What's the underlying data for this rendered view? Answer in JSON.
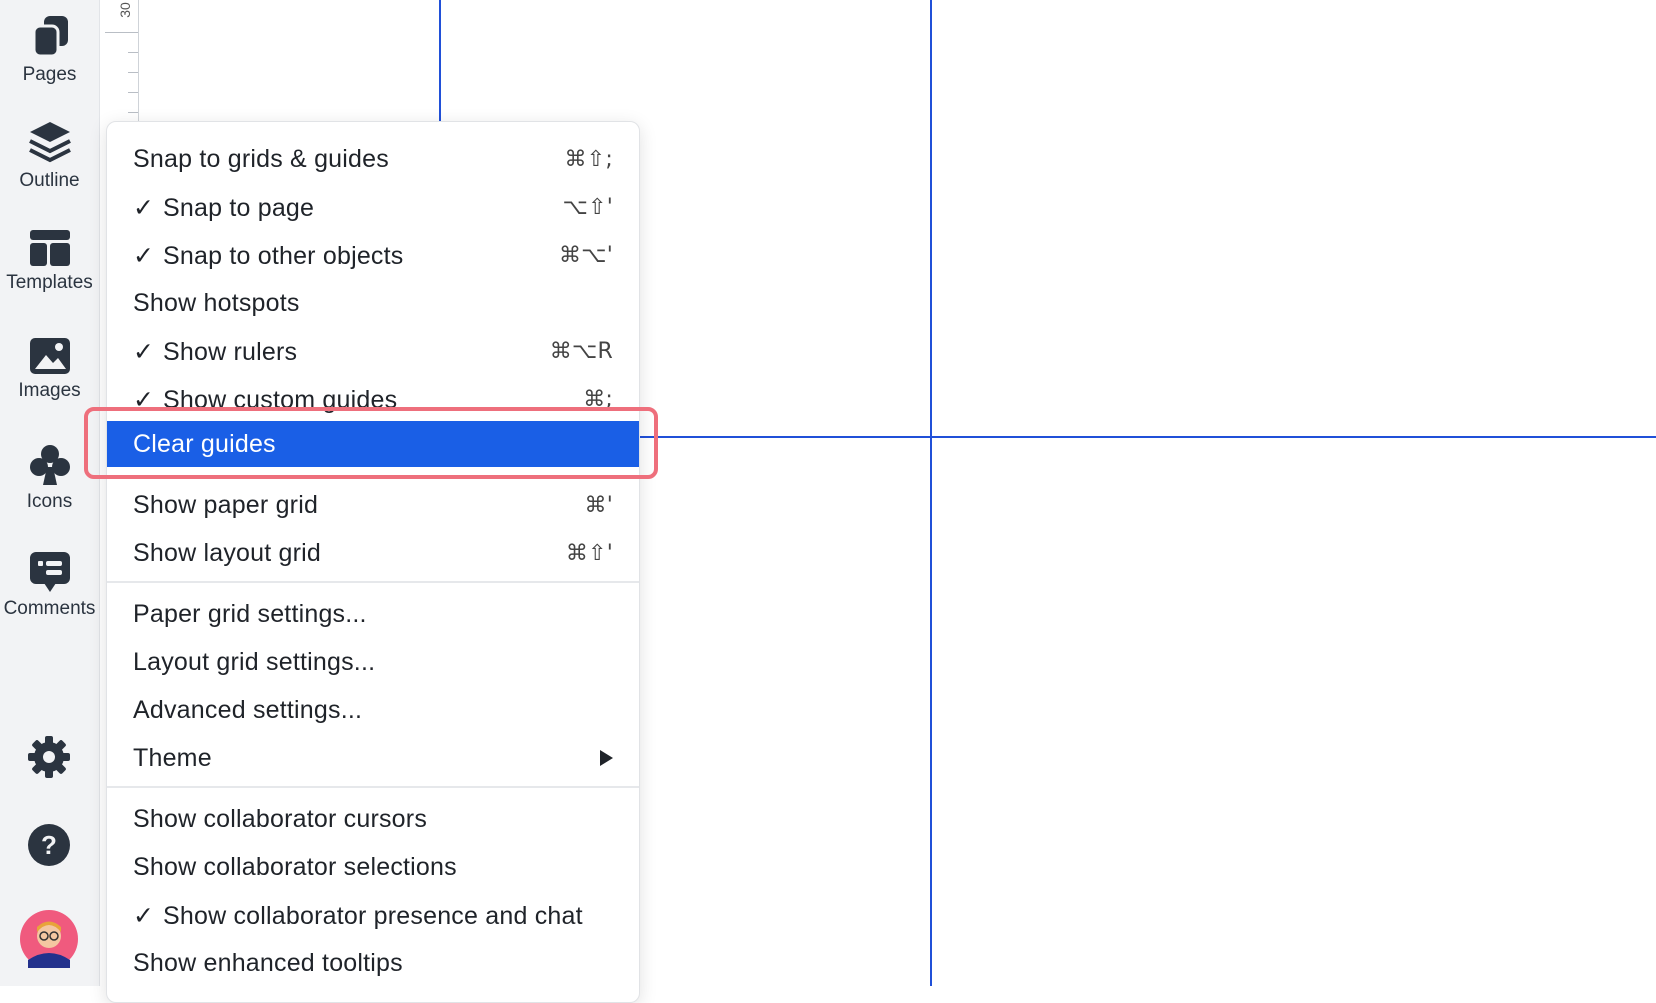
{
  "sidebar": {
    "items": [
      {
        "label": "Pages",
        "icon": "pages-icon"
      },
      {
        "label": "Outline",
        "icon": "layers-icon"
      },
      {
        "label": "Templates",
        "icon": "templates-icon"
      },
      {
        "label": "Images",
        "icon": "image-icon"
      },
      {
        "label": "Icons",
        "icon": "club-icon"
      },
      {
        "label": "Comments",
        "icon": "comment-icon"
      }
    ],
    "bottom": [
      "gear-icon",
      "help-icon",
      "avatar"
    ]
  },
  "ruler": {
    "label": "30"
  },
  "menu": {
    "items": [
      {
        "label": "Snap to grids & guides",
        "checked": "",
        "shortcut": "⌘⇧;"
      },
      {
        "label": "Snap to page",
        "checked": "✓",
        "shortcut": "⌥⇧'"
      },
      {
        "label": "Snap to other objects",
        "checked": "✓",
        "shortcut": "⌘⌥'"
      },
      {
        "label": "Show hotspots",
        "checked": "",
        "shortcut": ""
      },
      {
        "label": "Show rulers",
        "checked": "✓",
        "shortcut": "⌘⌥R"
      },
      {
        "label": "Show custom guides",
        "checked": "✓",
        "shortcut": "⌘;"
      },
      {
        "label": "Clear guides",
        "checked": "",
        "shortcut": ""
      },
      {
        "label": "Show paper grid",
        "checked": "",
        "shortcut": "⌘'"
      },
      {
        "label": "Show layout grid",
        "checked": "",
        "shortcut": "⌘⇧'"
      },
      {
        "label": "Paper grid settings...",
        "checked": "",
        "shortcut": ""
      },
      {
        "label": "Layout grid settings...",
        "checked": "",
        "shortcut": ""
      },
      {
        "label": "Advanced settings...",
        "checked": "",
        "shortcut": ""
      },
      {
        "label": "Theme",
        "checked": "",
        "shortcut": ""
      },
      {
        "label": "Show collaborator cursors",
        "checked": "",
        "shortcut": ""
      },
      {
        "label": "Show collaborator selections",
        "checked": "",
        "shortcut": ""
      },
      {
        "label": "Show collaborator presence and chat",
        "checked": "✓",
        "shortcut": ""
      },
      {
        "label": "Show enhanced tooltips",
        "checked": "",
        "shortcut": ""
      }
    ]
  },
  "colors": {
    "accent": "#1a5fe6",
    "guide": "#2050d8",
    "focus_ring": "#ee6f7c"
  }
}
